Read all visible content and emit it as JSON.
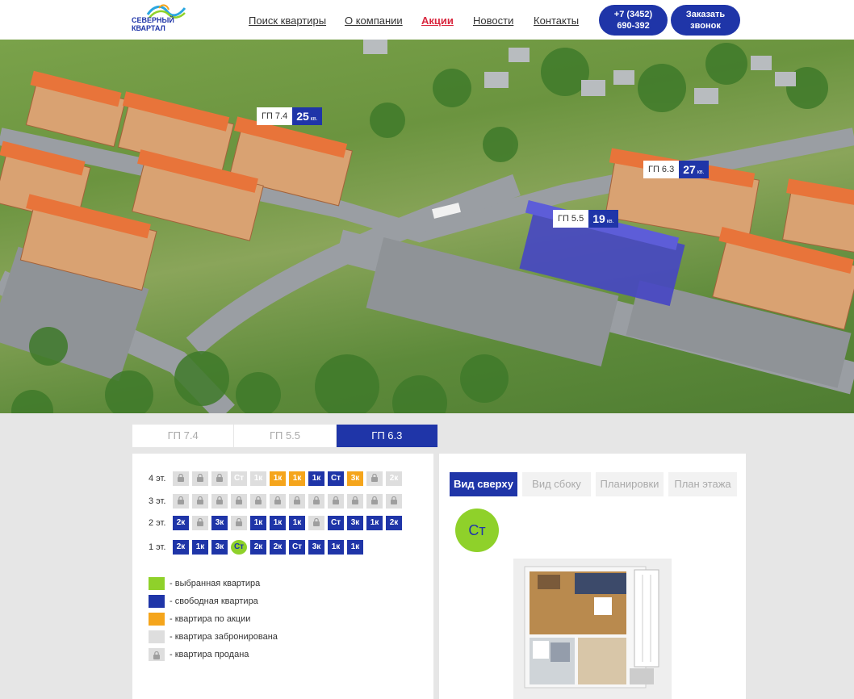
{
  "header": {
    "logo_line1": "СЕВЕРНЫЙ",
    "logo_line2": "КВАРТАЛ",
    "nav": [
      {
        "label": "Поиск квартиры",
        "active": false
      },
      {
        "label": "О компании",
        "active": false
      },
      {
        "label": "Акции",
        "active": true
      },
      {
        "label": "Новости",
        "active": false
      },
      {
        "label": "Контакты",
        "active": false
      }
    ],
    "phone_line1": "+7 (3452)",
    "phone_line2": "690-392",
    "callback_line1": "Заказать",
    "callback_line2": "звонок"
  },
  "hero": {
    "buildings": [
      {
        "name": "ГП 7.4",
        "count": "25",
        "unit": "кв."
      },
      {
        "name": "ГП 6.3",
        "count": "27",
        "unit": "кв."
      },
      {
        "name": "ГП 5.5",
        "count": "19",
        "unit": "кв."
      }
    ]
  },
  "tabs": [
    {
      "label": "ГП 7.4",
      "active": false
    },
    {
      "label": "ГП 5.5",
      "active": false
    },
    {
      "label": "ГП 6.3",
      "active": true
    }
  ],
  "floors": [
    {
      "label": "4 эт.",
      "cells": [
        {
          "t": "sold",
          "v": ""
        },
        {
          "t": "sold",
          "v": ""
        },
        {
          "t": "sold",
          "v": ""
        },
        {
          "t": "res",
          "v": "Ст"
        },
        {
          "t": "res",
          "v": "1к"
        },
        {
          "t": "promo",
          "v": "1к"
        },
        {
          "t": "promo",
          "v": "1к"
        },
        {
          "t": "free",
          "v": "1к"
        },
        {
          "t": "free",
          "v": "Ст"
        },
        {
          "t": "promo",
          "v": "3к"
        },
        {
          "t": "sold",
          "v": ""
        },
        {
          "t": "res",
          "v": "2к"
        }
      ]
    },
    {
      "label": "3 эт.",
      "cells": [
        {
          "t": "sold",
          "v": ""
        },
        {
          "t": "sold",
          "v": ""
        },
        {
          "t": "sold",
          "v": ""
        },
        {
          "t": "sold",
          "v": ""
        },
        {
          "t": "sold",
          "v": ""
        },
        {
          "t": "sold",
          "v": ""
        },
        {
          "t": "sold",
          "v": ""
        },
        {
          "t": "sold",
          "v": ""
        },
        {
          "t": "sold",
          "v": ""
        },
        {
          "t": "sold",
          "v": ""
        },
        {
          "t": "sold",
          "v": ""
        },
        {
          "t": "sold",
          "v": ""
        }
      ]
    },
    {
      "label": "2 эт.",
      "cells": [
        {
          "t": "free",
          "v": "2к"
        },
        {
          "t": "sold",
          "v": ""
        },
        {
          "t": "free",
          "v": "3к"
        },
        {
          "t": "sold",
          "v": ""
        },
        {
          "t": "free",
          "v": "1к"
        },
        {
          "t": "free",
          "v": "1к"
        },
        {
          "t": "free",
          "v": "1к"
        },
        {
          "t": "sold",
          "v": ""
        },
        {
          "t": "free",
          "v": "Ст"
        },
        {
          "t": "free",
          "v": "3к"
        },
        {
          "t": "free",
          "v": "1к"
        },
        {
          "t": "free",
          "v": "2к"
        }
      ]
    },
    {
      "label": "1 эт.",
      "cells": [
        {
          "t": "free",
          "v": "2к"
        },
        {
          "t": "free",
          "v": "1к"
        },
        {
          "t": "free",
          "v": "3к"
        },
        {
          "t": "sel",
          "v": "Ст"
        },
        {
          "t": "free",
          "v": "2к"
        },
        {
          "t": "free",
          "v": "2к"
        },
        {
          "t": "free",
          "v": "Ст"
        },
        {
          "t": "free",
          "v": "3к"
        },
        {
          "t": "free",
          "v": "1к"
        },
        {
          "t": "free",
          "v": "1к"
        }
      ]
    }
  ],
  "legend": [
    {
      "type": "sel",
      "label": "- выбранная квартира",
      "color": "#8fd12a"
    },
    {
      "type": "free",
      "label": "- свободная квартира",
      "color": "#1f35a8"
    },
    {
      "type": "promo",
      "label": "- квартира по акции",
      "color": "#f5a51c"
    },
    {
      "type": "res",
      "label": "- квартира забронирована",
      "color": "#dedede"
    },
    {
      "type": "sold",
      "label": "- квартира продана",
      "color": "#dedede"
    }
  ],
  "view_tabs": [
    {
      "label": "Вид сверху",
      "active": true
    },
    {
      "label": "Вид сбоку",
      "active": false
    },
    {
      "label": "Планировки",
      "active": false
    },
    {
      "label": "План этажа",
      "active": false
    }
  ],
  "selected_type": "Ст",
  "colors": {
    "brand": "#1f35a8",
    "accent": "#d9283f",
    "promo": "#f5a51c",
    "selected": "#8fd12a"
  }
}
